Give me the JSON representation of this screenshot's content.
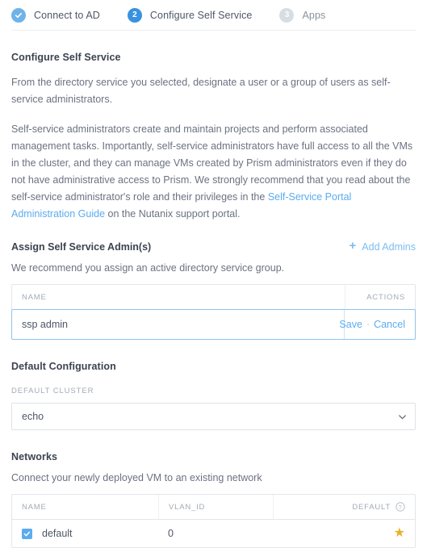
{
  "stepper": {
    "steps": [
      {
        "badge": "check-icon",
        "label": "Connect to AD",
        "state": "done"
      },
      {
        "badge": "2",
        "label": "Configure Self Service",
        "state": "current"
      },
      {
        "badge": "3",
        "label": "Apps",
        "state": "todo"
      }
    ]
  },
  "main": {
    "title": "Configure Self Service",
    "paragraph1": "From the directory service you selected, designate a user or a group of users as self-service administrators.",
    "paragraph2_before": "Self-service administrators create and maintain projects and perform associated management tasks. Importantly, self-service administrators have full access to all the VMs in the cluster, and they can manage VMs created by Prism administrators even if they do not have administrative access to Prism. We strongly recommend that you read about the self-service administrator's role and their privileges in the ",
    "paragraph2_link": "Self-Service Portal Administration Guide",
    "paragraph2_after": " on the Nutanix support portal."
  },
  "admins": {
    "title": "Assign Self Service Admin(s)",
    "add_label": "Add Admins",
    "add_icon": "plus-icon",
    "hint": "We recommend you assign an active directory service group.",
    "columns": {
      "name": "NAME",
      "actions": "ACTIONS"
    },
    "row": {
      "name": "ssp admin",
      "save_label": "Save",
      "separator": "·",
      "cancel_label": "Cancel"
    }
  },
  "default_config": {
    "title": "Default Configuration",
    "cluster_label": "DEFAULT CLUSTER",
    "cluster_value": "echo",
    "chevron_icon": "chevron-down-icon"
  },
  "networks": {
    "title": "Networks",
    "hint": "Connect your newly deployed VM to an existing network",
    "columns": {
      "name": "NAME",
      "vlan": "VLAN_ID",
      "default": "DEFAULT"
    },
    "help_icon": "question-circle-icon",
    "rows": [
      {
        "checked": true,
        "name": "default",
        "vlan": "0",
        "default_icon": "star-icon"
      }
    ]
  },
  "colors": {
    "accent_blue": "#5bacef",
    "step_current": "#3892e0",
    "step_done": "#6fb3e8",
    "step_todo": "#d7dde3",
    "star_gold": "#e7b22c",
    "text": "#4e5666"
  }
}
